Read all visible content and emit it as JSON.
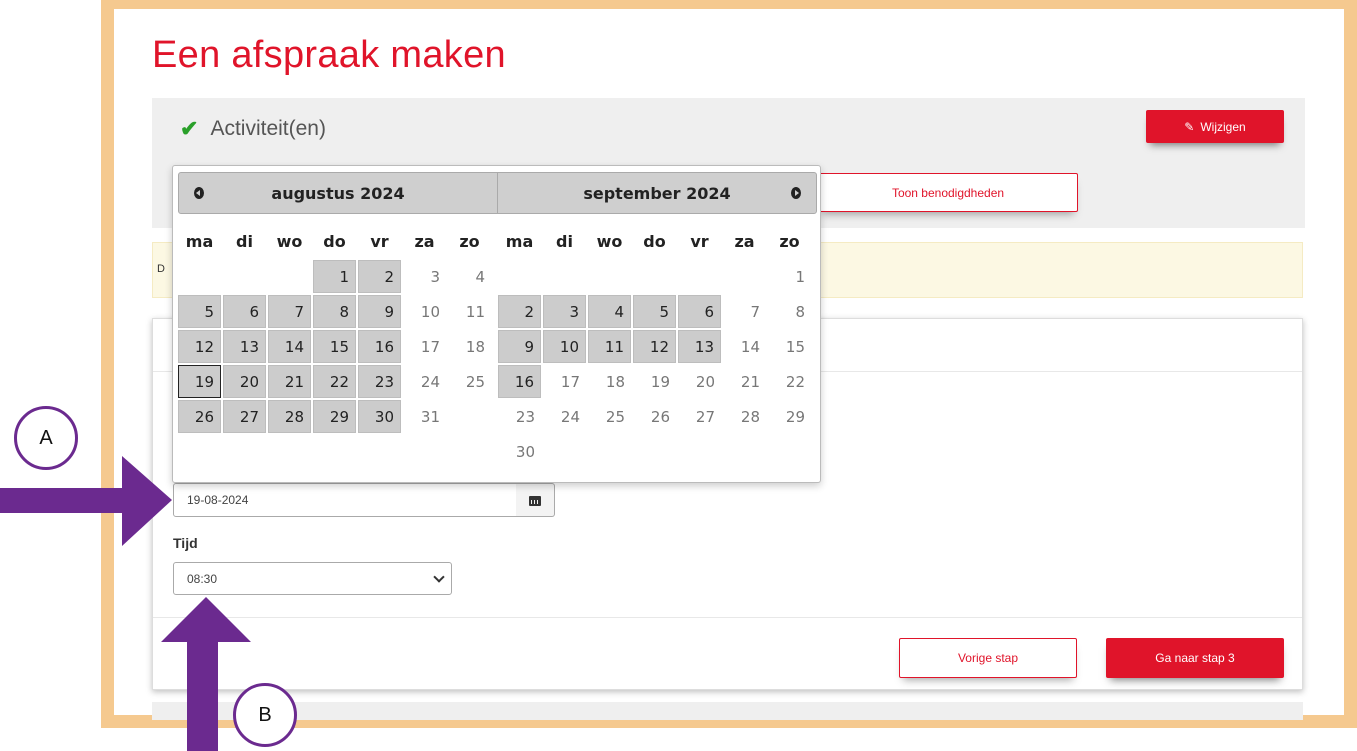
{
  "page": {
    "title": "Een afspraak maken"
  },
  "activity": {
    "label": "Activiteit(en)",
    "edit_label": "Wijzigen",
    "show_needs_label": "Toon benodigdheden"
  },
  "notice": {
    "text": "D"
  },
  "datepicker": {
    "months": [
      {
        "title": "augustus 2024",
        "weekdays": [
          "ma",
          "di",
          "wo",
          "do",
          "vr",
          "za",
          "zo"
        ],
        "leading_blanks": 3,
        "days": [
          {
            "d": "1",
            "s": "avail"
          },
          {
            "d": "2",
            "s": "avail"
          },
          {
            "d": "3",
            "s": "na"
          },
          {
            "d": "4",
            "s": "na"
          },
          {
            "d": "5",
            "s": "avail"
          },
          {
            "d": "6",
            "s": "avail"
          },
          {
            "d": "7",
            "s": "avail"
          },
          {
            "d": "8",
            "s": "avail"
          },
          {
            "d": "9",
            "s": "avail"
          },
          {
            "d": "10",
            "s": "na"
          },
          {
            "d": "11",
            "s": "na"
          },
          {
            "d": "12",
            "s": "avail"
          },
          {
            "d": "13",
            "s": "avail"
          },
          {
            "d": "14",
            "s": "avail"
          },
          {
            "d": "15",
            "s": "avail"
          },
          {
            "d": "16",
            "s": "avail"
          },
          {
            "d": "17",
            "s": "na"
          },
          {
            "d": "18",
            "s": "na"
          },
          {
            "d": "19",
            "s": "sel"
          },
          {
            "d": "20",
            "s": "avail"
          },
          {
            "d": "21",
            "s": "avail"
          },
          {
            "d": "22",
            "s": "avail"
          },
          {
            "d": "23",
            "s": "avail"
          },
          {
            "d": "24",
            "s": "na"
          },
          {
            "d": "25",
            "s": "na"
          },
          {
            "d": "26",
            "s": "avail"
          },
          {
            "d": "27",
            "s": "avail"
          },
          {
            "d": "28",
            "s": "avail"
          },
          {
            "d": "29",
            "s": "avail"
          },
          {
            "d": "30",
            "s": "avail"
          },
          {
            "d": "31",
            "s": "na"
          }
        ]
      },
      {
        "title": "september 2024",
        "weekdays": [
          "ma",
          "di",
          "wo",
          "do",
          "vr",
          "za",
          "zo"
        ],
        "leading_blanks": 6,
        "days": [
          {
            "d": "1",
            "s": "na"
          },
          {
            "d": "2",
            "s": "avail"
          },
          {
            "d": "3",
            "s": "avail"
          },
          {
            "d": "4",
            "s": "avail"
          },
          {
            "d": "5",
            "s": "avail"
          },
          {
            "d": "6",
            "s": "avail"
          },
          {
            "d": "7",
            "s": "na"
          },
          {
            "d": "8",
            "s": "na"
          },
          {
            "d": "9",
            "s": "avail"
          },
          {
            "d": "10",
            "s": "avail"
          },
          {
            "d": "11",
            "s": "avail"
          },
          {
            "d": "12",
            "s": "avail"
          },
          {
            "d": "13",
            "s": "avail"
          },
          {
            "d": "14",
            "s": "na"
          },
          {
            "d": "15",
            "s": "na"
          },
          {
            "d": "16",
            "s": "avail"
          },
          {
            "d": "17",
            "s": "na"
          },
          {
            "d": "18",
            "s": "na"
          },
          {
            "d": "19",
            "s": "na"
          },
          {
            "d": "20",
            "s": "na"
          },
          {
            "d": "21",
            "s": "na"
          },
          {
            "d": "22",
            "s": "na"
          },
          {
            "d": "23",
            "s": "na"
          },
          {
            "d": "24",
            "s": "na"
          },
          {
            "d": "25",
            "s": "na"
          },
          {
            "d": "26",
            "s": "na"
          },
          {
            "d": "27",
            "s": "na"
          },
          {
            "d": "28",
            "s": "na"
          },
          {
            "d": "29",
            "s": "na"
          },
          {
            "d": "30",
            "s": "na"
          }
        ]
      }
    ]
  },
  "form": {
    "date_value": "19-08-2024",
    "time_label": "Tijd",
    "time_value": "08:30"
  },
  "nav": {
    "prev_label": "Vorige stap",
    "next_label": "Ga naar stap 3"
  },
  "annotations": {
    "a": "A",
    "b": "B"
  },
  "colors": {
    "brand": "#e0142a",
    "frame": "#f5c98f",
    "annotation": "#6b2a8f",
    "check": "#2aa02a"
  }
}
